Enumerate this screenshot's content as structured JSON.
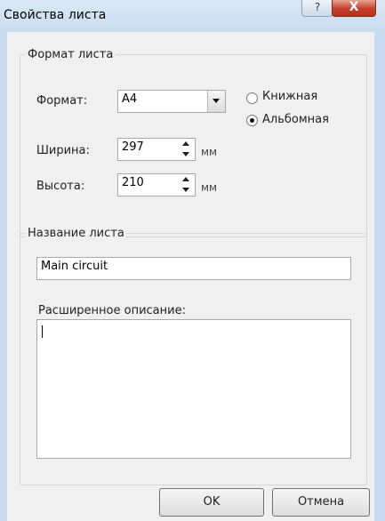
{
  "window": {
    "title": "Свойства листа",
    "help_label": "?",
    "close_label": "X"
  },
  "sheet_format": {
    "legend": "Формат листа",
    "format_label": "Формат:",
    "format_value": "A4",
    "width_label": "Ширина:",
    "width_value": "297",
    "width_unit": "мм",
    "height_label": "Высота:",
    "height_value": "210",
    "height_unit": "мм",
    "orientation": {
      "portrait_label": "Книжная",
      "landscape_label": "Альбомная",
      "selected": "landscape"
    }
  },
  "sheet_name": {
    "legend": "Название листа",
    "name_value": "Main circuit",
    "description_label": "Расширенное описание:",
    "description_value": ""
  },
  "buttons": {
    "ok_label": "OK",
    "cancel_label": "Отмена"
  }
}
